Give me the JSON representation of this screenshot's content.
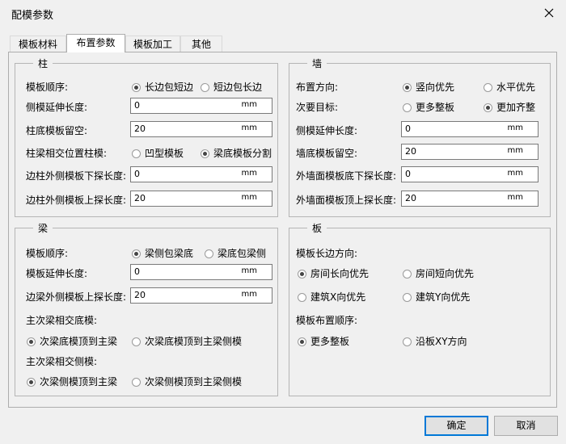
{
  "window": {
    "title": "配模参数"
  },
  "tabs": [
    "模板材料",
    "布置参数",
    "模板加工",
    "其他"
  ],
  "column": {
    "legend": "柱",
    "order_label": "模板顺序:",
    "order_opt1": "长边包短边",
    "order_opt2": "短边包长边",
    "side_ext_label": "侧模延伸长度:",
    "side_ext_value": "0",
    "bottom_gap_label": "柱底模板留空:",
    "bottom_gap_value": "20",
    "beam_pos_label": "柱梁相交位置柱模:",
    "beam_pos_opt1": "凹型模板",
    "beam_pos_opt2": "梁底模板分割",
    "edge_down_label": "边柱外侧模板下探长度:",
    "edge_down_value": "0",
    "edge_up_label": "边柱外侧模板上探长度:",
    "edge_up_value": "20"
  },
  "wall": {
    "legend": "墙",
    "dir_label": "布置方向:",
    "dir_opt1": "竖向优先",
    "dir_opt2": "水平优先",
    "goal_label": "次要目标:",
    "goal_opt1": "更多整板",
    "goal_opt2": "更加齐整",
    "side_ext_label": "侧模延伸长度:",
    "side_ext_value": "0",
    "bottom_gap_label": "墙底模板留空:",
    "bottom_gap_value": "20",
    "ext_down_label": "外墙面模板底下探长度:",
    "ext_down_value": "0",
    "ext_up_label": "外墙面模板顶上探长度:",
    "ext_up_value": "20"
  },
  "beam": {
    "legend": "梁",
    "order_label": "模板顺序:",
    "order_opt1": "梁侧包梁底",
    "order_opt2": "梁底包梁侧",
    "ext_label": "模板延伸长度:",
    "ext_value": "0",
    "edge_up_label": "边梁外侧模板上探长度:",
    "edge_up_value": "20",
    "bottom_label": "主次梁相交底模:",
    "bottom_opt1": "次梁底模顶到主梁",
    "bottom_opt2": "次梁底模顶到主梁侧模",
    "side_label": "主次梁相交侧模:",
    "side_opt1": "次梁侧模顶到主梁",
    "side_opt2": "次梁侧模顶到主梁侧模"
  },
  "slab": {
    "legend": "板",
    "long_dir_label": "模板长边方向:",
    "opt_room_long": "房间长向优先",
    "opt_room_short": "房间短向优先",
    "opt_x": "建筑X向优先",
    "opt_y": "建筑Y向优先",
    "layout_label": "模板布置顺序:",
    "layout_opt1": "更多整板",
    "layout_opt2": "沿板XY方向"
  },
  "unit": "mm",
  "buttons": {
    "ok": "确定",
    "cancel": "取消"
  }
}
